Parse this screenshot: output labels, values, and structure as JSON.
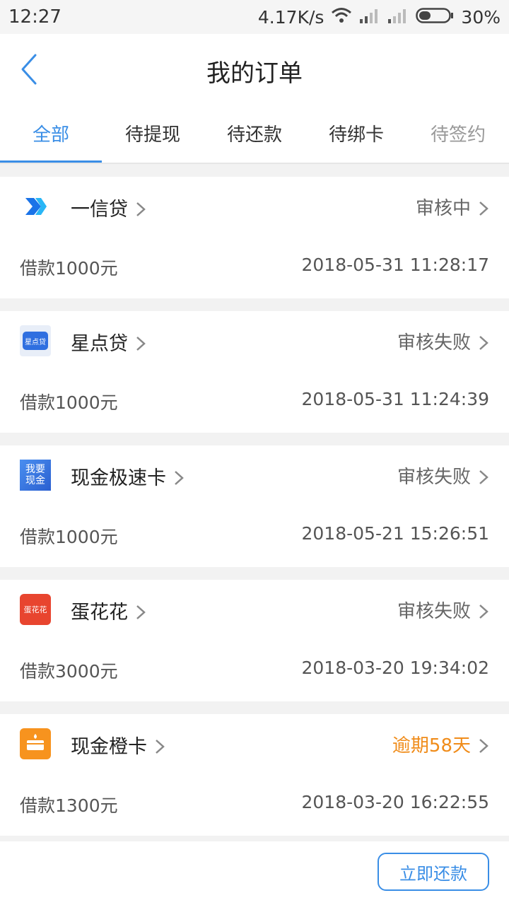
{
  "status_bar": {
    "time": "12:27",
    "speed": "4.17K/s",
    "battery": "30%",
    "icons": [
      "wifi-icon",
      "signal-icon",
      "signal-icon",
      "battery-icon"
    ]
  },
  "header": {
    "title": "我的订单",
    "back_icon": "chevron-left-icon"
  },
  "tabs": [
    {
      "label": "全部",
      "active": true
    },
    {
      "label": "待提现",
      "active": false
    },
    {
      "label": "待还款",
      "active": false
    },
    {
      "label": "待绑卡",
      "active": false
    },
    {
      "label": "待签约",
      "active": false
    }
  ],
  "orders": [
    {
      "name": "一信贷",
      "status": "审核中",
      "amount": "借款1000元",
      "time": "2018-05-31 11:28:17",
      "logo_text": ""
    },
    {
      "name": "星点贷",
      "status": "审核失败",
      "amount": "借款1000元",
      "time": "2018-05-31 11:24:39",
      "logo_text": "星点贷"
    },
    {
      "name": "现金极速卡",
      "status": "审核失败",
      "amount": "借款1000元",
      "time": "2018-05-21 15:26:51",
      "logo_text": "我要现金"
    },
    {
      "name": "蛋花花",
      "status": "审核失败",
      "amount": "借款3000元",
      "time": "2018-03-20 19:34:02",
      "logo_text": "蛋花花"
    },
    {
      "name": "现金橙卡",
      "status": "逾期58天",
      "amount": "借款1300元",
      "time": "2018-03-20 16:22:55",
      "logo_text": ""
    }
  ],
  "footer": {
    "repay_label": "立即还款"
  },
  "colors": {
    "accent": "#3a8ee6",
    "overdue": "#f08c1a",
    "background": "#f2f2f2"
  }
}
